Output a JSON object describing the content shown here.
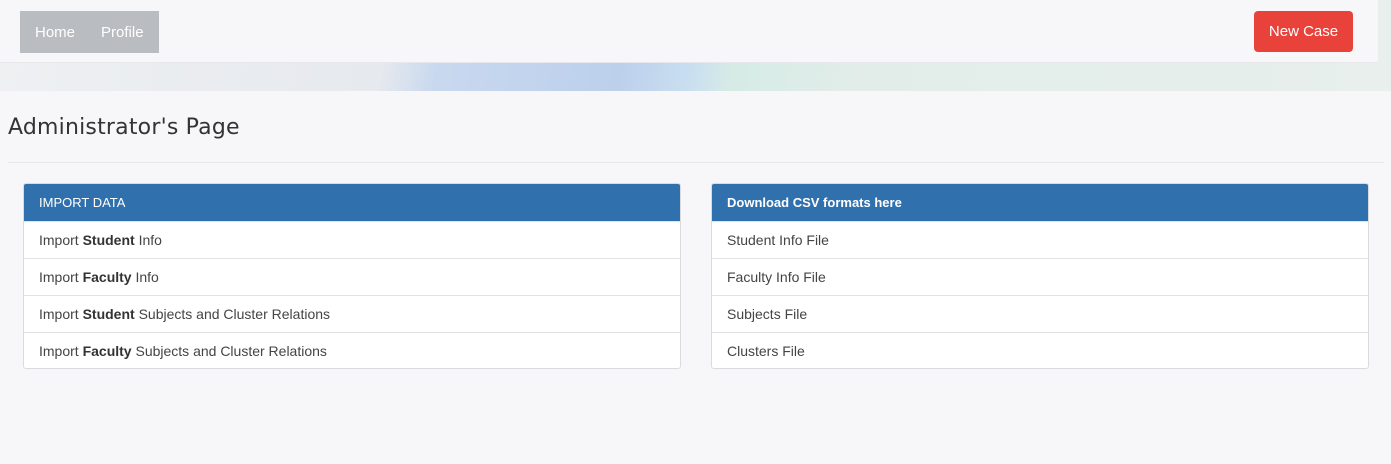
{
  "nav": {
    "links": [
      "Home",
      "Profile"
    ],
    "new_case_label": "New Case"
  },
  "page": {
    "title": "Administrator's Page"
  },
  "import_panel": {
    "heading": "IMPORT DATA",
    "items": [
      {
        "pre": "Import ",
        "bold": "Student",
        "post": " Info"
      },
      {
        "pre": "Import ",
        "bold": "Faculty",
        "post": " Info"
      },
      {
        "pre": "Import ",
        "bold": "Student",
        "post": " Subjects and Cluster Relations"
      },
      {
        "pre": "Import ",
        "bold": "Faculty",
        "post": " Subjects and Cluster Relations"
      }
    ]
  },
  "download_panel": {
    "heading": "Download CSV formats here",
    "items": [
      "Student Info File",
      "Faculty Info File",
      "Subjects File",
      "Clusters File"
    ]
  },
  "colors": {
    "primary": "#2f70ad",
    "danger": "#e8423b",
    "nav_bg": "#b9bcc0",
    "page_bg": "#f7f7f9"
  }
}
